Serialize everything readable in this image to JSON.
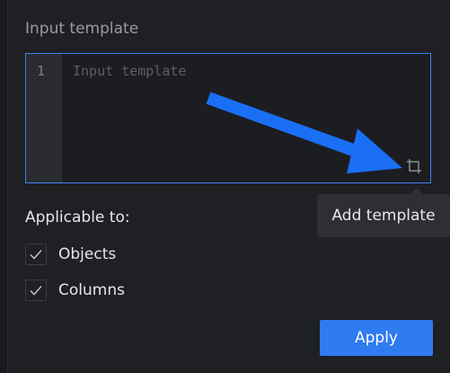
{
  "editor_section": {
    "label": "Input template",
    "line_number": "1",
    "placeholder": "Input template",
    "value": ""
  },
  "tooltip": {
    "text": "Add template"
  },
  "applicable": {
    "title": "Applicable to:",
    "options": [
      {
        "label": "Objects",
        "checked": true
      },
      {
        "label": "Columns",
        "checked": true
      }
    ]
  },
  "actions": {
    "apply_label": "Apply"
  },
  "colors": {
    "accent": "#2f7bf0",
    "arrow": "#1a6ff5",
    "background": "#1f2024"
  }
}
